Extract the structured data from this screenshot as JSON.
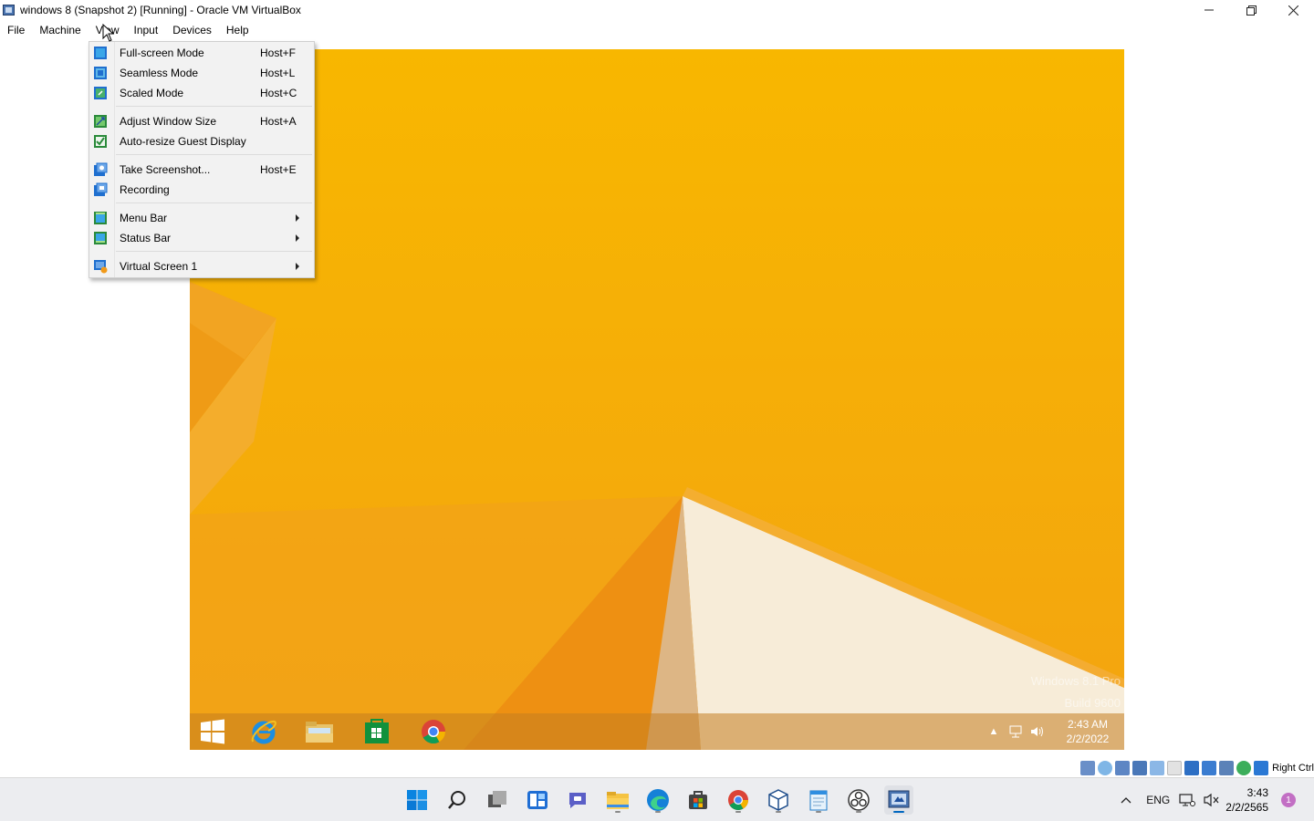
{
  "window": {
    "title": "windows 8 (Snapshot 2) [Running] - Oracle VM VirtualBox",
    "controls": {
      "minimize_icon": "minimize-icon",
      "maximize_icon": "restore-icon",
      "close_icon": "close-icon"
    }
  },
  "menubar": {
    "items": [
      {
        "label": "File"
      },
      {
        "label": "Machine"
      },
      {
        "label": "View"
      },
      {
        "label": "Input"
      },
      {
        "label": "Devices"
      },
      {
        "label": "Help"
      }
    ]
  },
  "view_menu": {
    "items": [
      {
        "label": "Full-screen Mode",
        "shortcut": "Host+F",
        "icon": "fullscreen-icon"
      },
      {
        "label": "Seamless Mode",
        "shortcut": "Host+L",
        "icon": "seamless-icon"
      },
      {
        "label": "Scaled Mode",
        "shortcut": "Host+C",
        "icon": "scaled-icon"
      },
      {
        "label": "Adjust Window Size",
        "shortcut": "Host+A",
        "icon": "adjust-window-icon"
      },
      {
        "label": "Auto-resize Guest Display",
        "shortcut": "",
        "icon": "auto-resize-icon"
      },
      {
        "label": "Take Screenshot...",
        "shortcut": "Host+E",
        "icon": "screenshot-icon"
      },
      {
        "label": "Recording",
        "shortcut": "",
        "icon": "recording-icon"
      },
      {
        "label": "Menu Bar",
        "shortcut": "",
        "icon": "menu-bar-icon",
        "submenu": true
      },
      {
        "label": "Status Bar",
        "shortcut": "",
        "icon": "status-bar-icon",
        "submenu": true
      },
      {
        "label": "Virtual Screen 1",
        "shortcut": "",
        "icon": "virtual-screen-icon",
        "submenu": true
      }
    ]
  },
  "guest": {
    "watermark": {
      "line1": "Windows 8.1 Pro",
      "line2": "Build 9600"
    },
    "taskbar": {
      "apps": [
        {
          "name": "start",
          "icon": "windows-start-icon"
        },
        {
          "name": "internet-explorer",
          "icon": "internet-explorer-icon"
        },
        {
          "name": "file-explorer",
          "icon": "file-explorer-icon"
        },
        {
          "name": "store",
          "icon": "store-icon"
        },
        {
          "name": "chrome",
          "icon": "chrome-icon"
        }
      ],
      "clock": {
        "time": "2:43 AM",
        "date": "2/2/2022"
      }
    },
    "colors": {
      "wallpaper": "#f6b300",
      "accent_orange": "#ef8e0a"
    }
  },
  "statusbar": {
    "host_key": "Right Ctrl"
  },
  "host_taskbar": {
    "apps": [
      {
        "name": "start",
        "icon": "windows-11-start-icon"
      },
      {
        "name": "search",
        "icon": "search-icon"
      },
      {
        "name": "task-view",
        "icon": "task-view-icon"
      },
      {
        "name": "widgets",
        "icon": "widgets-icon"
      },
      {
        "name": "chat",
        "icon": "teams-chat-icon"
      },
      {
        "name": "file-explorer",
        "icon": "file-explorer-icon"
      },
      {
        "name": "edge",
        "icon": "edge-icon"
      },
      {
        "name": "store",
        "icon": "store-icon"
      },
      {
        "name": "chrome",
        "icon": "chrome-icon"
      },
      {
        "name": "virtualbox-app",
        "icon": "box-icon"
      },
      {
        "name": "notepad",
        "icon": "notepad-icon"
      },
      {
        "name": "obs",
        "icon": "obs-icon"
      },
      {
        "name": "virtualbox",
        "icon": "virtualbox-icon"
      }
    ],
    "tray": {
      "language": "ENG",
      "time": "3:43",
      "date": "2/2/2565",
      "notification_count": "1"
    }
  }
}
